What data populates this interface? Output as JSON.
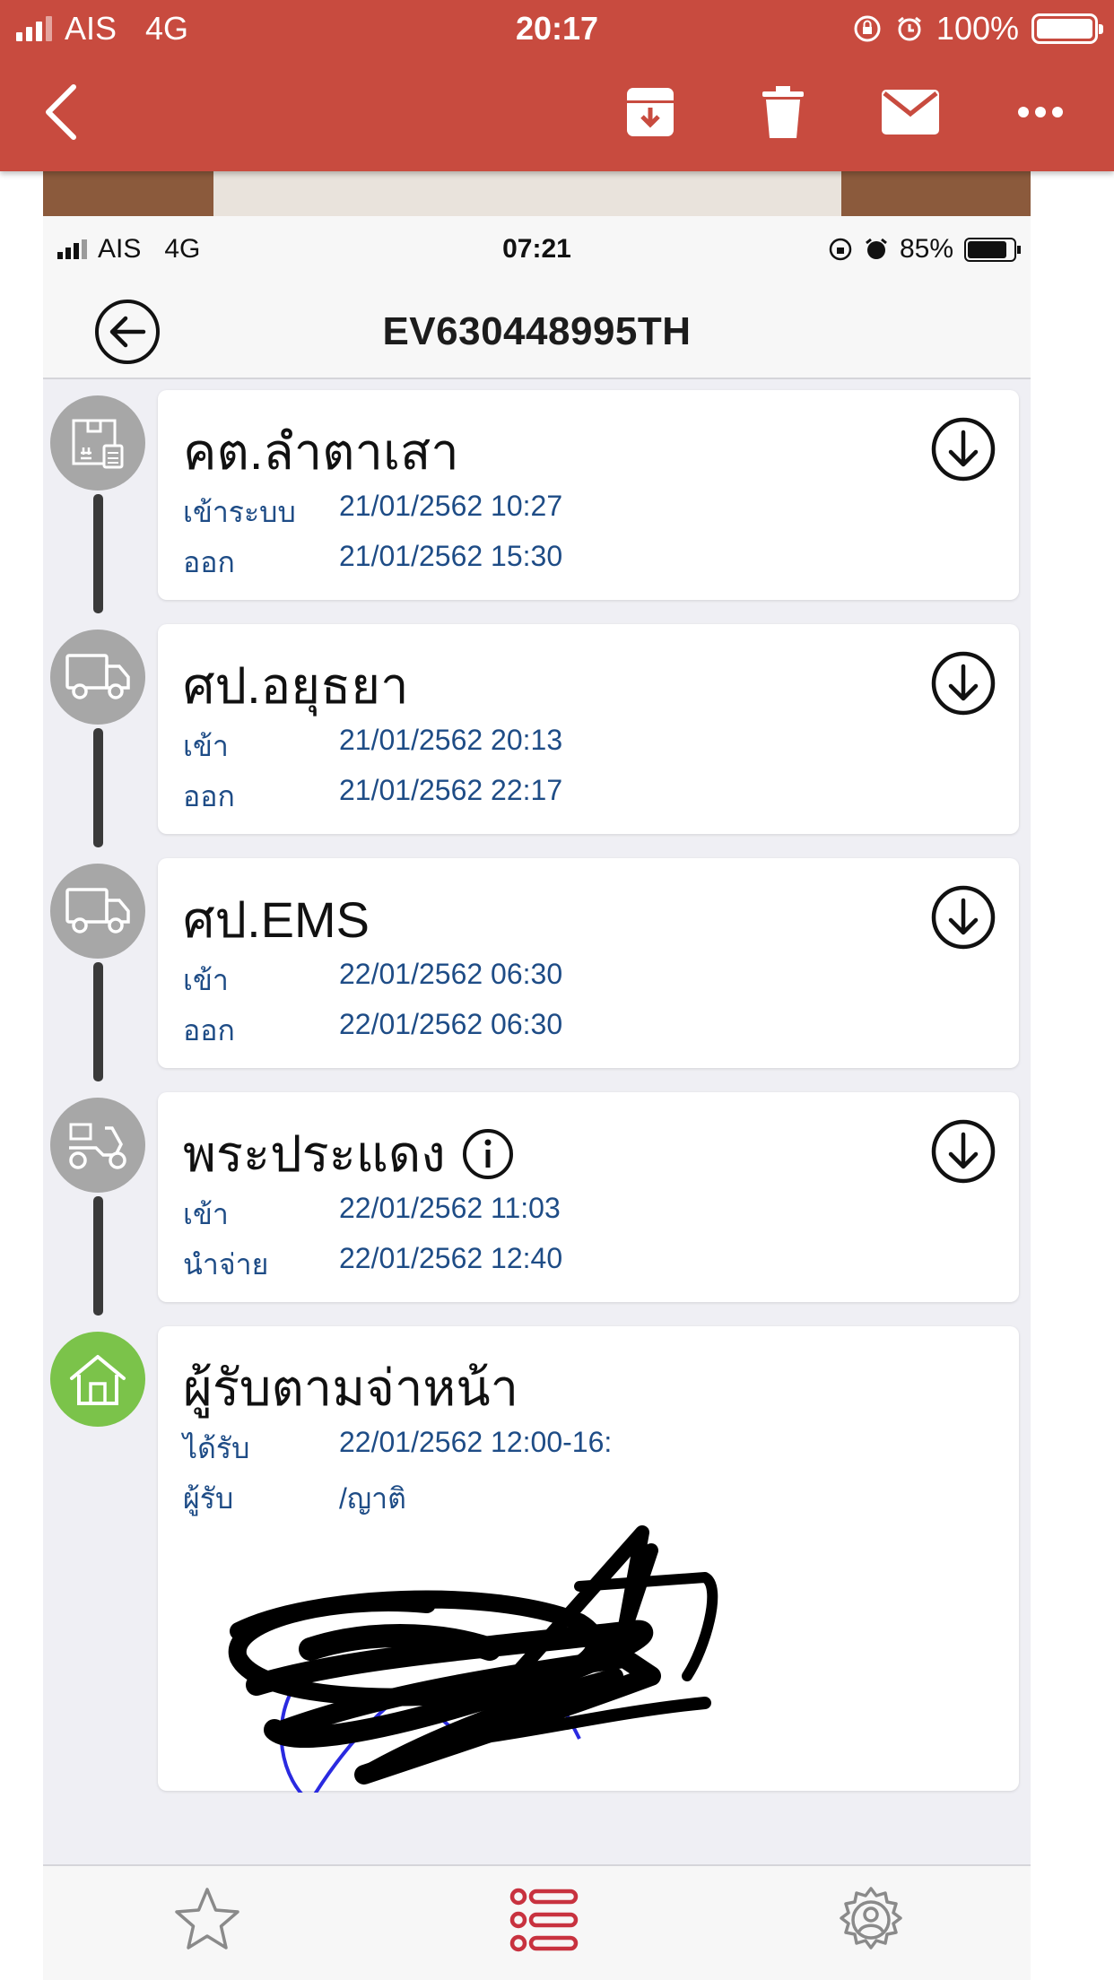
{
  "outer_status": {
    "carrier": "AIS",
    "network": "4G",
    "time": "20:17",
    "battery": "100%"
  },
  "outer_toolbar": {
    "back_icon": "chevron-left-icon",
    "actions": [
      "archive-icon",
      "trash-icon",
      "mail-icon",
      "more-icon"
    ]
  },
  "inner_status": {
    "carrier": "AIS",
    "network": "4G",
    "time": "07:21",
    "battery": "85%"
  },
  "header": {
    "title": "EV630448995TH",
    "back_icon": "back-arrow-icon"
  },
  "timeline": [
    {
      "icon": "package-icon",
      "name": "คต.ลำตาเสา",
      "rows": [
        {
          "label": "เข้าระบบ",
          "value": "21/01/2562 10:27"
        },
        {
          "label": "ออก",
          "value": "21/01/2562 15:30"
        }
      ]
    },
    {
      "icon": "truck-icon",
      "name": "ศป.อยุธยา",
      "rows": [
        {
          "label": "เข้า",
          "value": "21/01/2562 20:13"
        },
        {
          "label": "ออก",
          "value": "21/01/2562 22:17"
        }
      ]
    },
    {
      "icon": "truck-icon",
      "name": "ศป.EMS",
      "rows": [
        {
          "label": "เข้า",
          "value": "22/01/2562 06:30"
        },
        {
          "label": "ออก",
          "value": "22/01/2562 06:30"
        }
      ]
    },
    {
      "icon": "scooter-icon",
      "name": "พระประแดง",
      "info": true,
      "rows": [
        {
          "label": "เข้า",
          "value": "22/01/2562 11:03"
        },
        {
          "label": "นำจ่าย",
          "value": "22/01/2562 12:40"
        }
      ]
    },
    {
      "icon": "home-icon",
      "name": "ผู้รับตามจ่าหน้า",
      "rows": [
        {
          "label": "ได้รับ",
          "value": "22/01/2562 12:00-16:"
        },
        {
          "label": "ผู้รับ",
          "value": "/ญาติ"
        }
      ]
    }
  ],
  "tabs": [
    "favorites-star-icon",
    "list-icon",
    "settings-gear-icon"
  ],
  "colors": {
    "header_red": "#c84b3f",
    "accent_red": "#c8323f",
    "label_blue": "#1e4c86",
    "node_gray": "#a7a7a7",
    "node_green": "#7bc34a"
  }
}
